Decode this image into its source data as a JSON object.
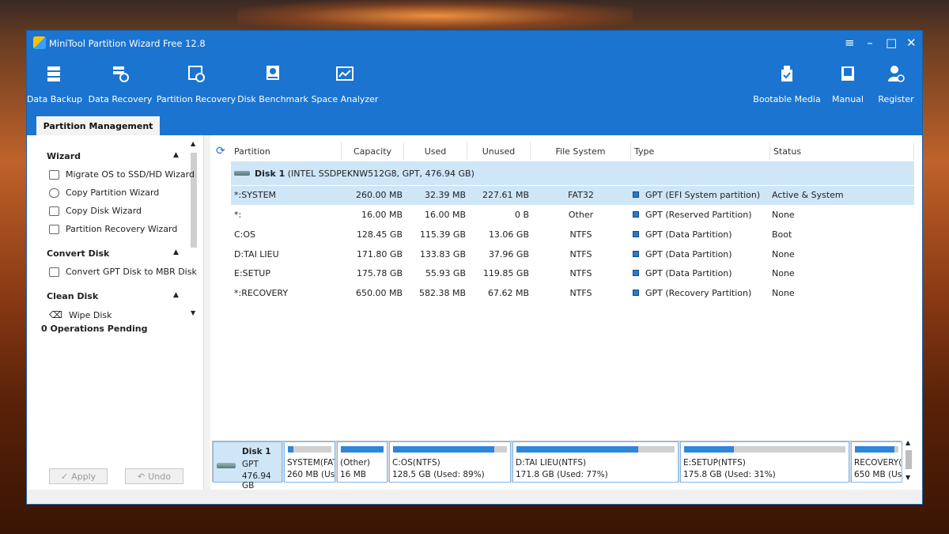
{
  "window": {
    "title": "MiniTool Partition Wizard Free 12.8"
  },
  "toolbar": {
    "left": [
      {
        "label": "Data Backup",
        "icon": "data-backup-icon"
      },
      {
        "label": "Data Recovery",
        "icon": "data-recovery-icon"
      },
      {
        "label": "Partition Recovery",
        "icon": "partition-recovery-icon"
      },
      {
        "label": "Disk Benchmark",
        "icon": "disk-benchmark-icon"
      },
      {
        "label": "Space Analyzer",
        "icon": "space-analyzer-icon"
      }
    ],
    "right": [
      {
        "label": "Bootable Media",
        "icon": "bootable-media-icon"
      },
      {
        "label": "Manual",
        "icon": "manual-icon"
      },
      {
        "label": "Register",
        "icon": "register-icon"
      }
    ]
  },
  "tab": {
    "label": "Partition Management"
  },
  "sidebar": {
    "sections": [
      {
        "title": "Wizard",
        "items": [
          "Migrate OS to SSD/HD Wizard",
          "Copy Partition Wizard",
          "Copy Disk Wizard",
          "Partition Recovery Wizard"
        ]
      },
      {
        "title": "Convert Disk",
        "items": [
          "Convert GPT Disk to MBR Disk"
        ]
      },
      {
        "title": "Clean Disk",
        "items": [
          "Wipe Disk"
        ]
      }
    ],
    "ops_pending": "0 Operations Pending",
    "apply_label": "Apply",
    "undo_label": "Undo"
  },
  "table": {
    "headers": [
      "Partition",
      "Capacity",
      "Used",
      "Unused",
      "File System",
      "Type",
      "Status"
    ],
    "disk_name": "Disk 1",
    "disk_info": "(INTEL SSDPEKNW512G8, GPT, 476.94 GB)",
    "rows": [
      {
        "partition": "*:SYSTEM",
        "capacity": "260.00 MB",
        "used": "32.39 MB",
        "unused": "227.61 MB",
        "fs": "FAT32",
        "type": "GPT (EFI System partition)",
        "status": "Active & System"
      },
      {
        "partition": "*:",
        "capacity": "16.00 MB",
        "used": "16.00 MB",
        "unused": "0 B",
        "fs": "Other",
        "type": "GPT (Reserved Partition)",
        "status": "None"
      },
      {
        "partition": "C:OS",
        "capacity": "128.45 GB",
        "used": "115.39 GB",
        "unused": "13.06 GB",
        "fs": "NTFS",
        "type": "GPT (Data Partition)",
        "status": "Boot"
      },
      {
        "partition": "D:TAI LIEU",
        "capacity": "171.80 GB",
        "used": "133.83 GB",
        "unused": "37.96 GB",
        "fs": "NTFS",
        "type": "GPT (Data Partition)",
        "status": "None"
      },
      {
        "partition": "E:SETUP",
        "capacity": "175.78 GB",
        "used": "55.93 GB",
        "unused": "119.85 GB",
        "fs": "NTFS",
        "type": "GPT (Data Partition)",
        "status": "None"
      },
      {
        "partition": "*:RECOVERY",
        "capacity": "650.00 MB",
        "used": "582.38 MB",
        "unused": "67.62 MB",
        "fs": "NTFS",
        "type": "GPT (Recovery Partition)",
        "status": "None"
      }
    ]
  },
  "diskmap": {
    "disk": {
      "name": "Disk 1",
      "style": "GPT",
      "size": "476.94 GB"
    },
    "parts": [
      {
        "line1": "SYSTEM(FAT",
        "line2": "260 MB (Us",
        "used_fraction": 0.12
      },
      {
        "line1": "(Other)",
        "line2": "16 MB",
        "used_fraction": 1.0
      },
      {
        "line1": "C:OS(NTFS)",
        "line2": "128.5 GB (Used: 89%)",
        "used_fraction": 0.89
      },
      {
        "line1": "D:TAI LIEU(NTFS)",
        "line2": "171.8 GB (Used: 77%)",
        "used_fraction": 0.77
      },
      {
        "line1": "E:SETUP(NTFS)",
        "line2": "175.8 GB (Used: 31%)",
        "used_fraction": 0.31
      },
      {
        "line1": "RECOVERY(I",
        "line2": "650 MB (Us",
        "used_fraction": 0.9
      }
    ]
  },
  "colors": {
    "titlebar": "#1b74d0",
    "selected_row": "#cfe6f7",
    "used_bar": "#2f86d6"
  }
}
